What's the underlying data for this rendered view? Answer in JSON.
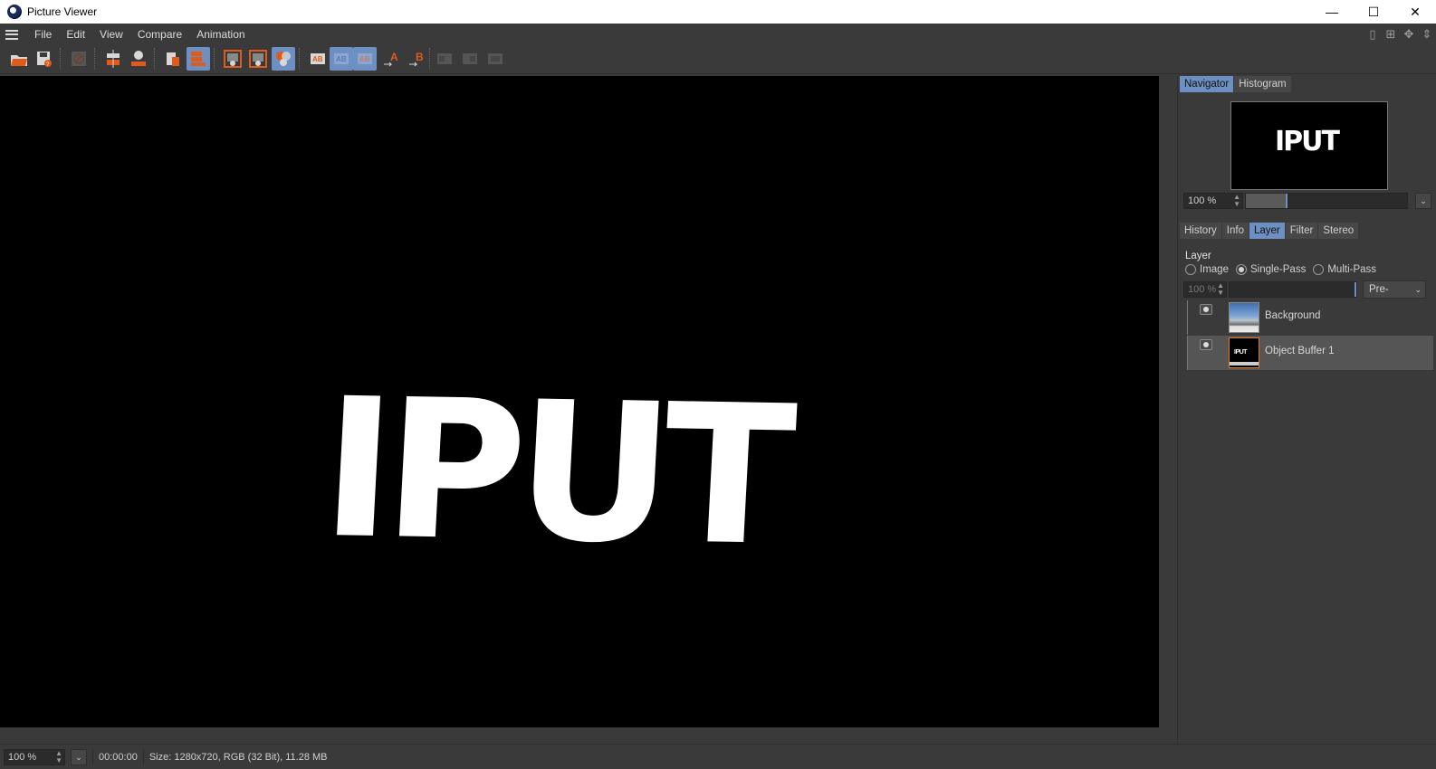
{
  "window": {
    "title": "Picture Viewer",
    "minimize": "—",
    "maximize": "☐",
    "close": "✕"
  },
  "menu": {
    "items": [
      "File",
      "Edit",
      "View",
      "Compare",
      "Animation"
    ]
  },
  "colors": {
    "accent": "#6e8fc2",
    "orange": "#e05a1a",
    "panel": "#3a3a3a"
  },
  "viewport": {
    "render_text": "IPUT"
  },
  "navigator": {
    "tabs": [
      "Navigator",
      "Histogram"
    ],
    "active_tab": "Navigator",
    "preview_text": "IPUT",
    "zoom": "100 %"
  },
  "panel_tabs": {
    "items": [
      "History",
      "Info",
      "Layer",
      "Filter",
      "Stereo"
    ],
    "active": "Layer"
  },
  "layer": {
    "section_label": "Layer",
    "modes": [
      "Image",
      "Single-Pass",
      "Multi-Pass"
    ],
    "selected_mode": "Single-Pass",
    "opacity": "100 %",
    "blend": "Pre-multiplied",
    "rows": [
      {
        "name": "Background"
      },
      {
        "name": "Object Buffer 1"
      }
    ]
  },
  "status": {
    "zoom": "100 %",
    "time": "00:00:00",
    "info": "Size: 1280x720, RGB (32 Bit), 11.28 MB"
  }
}
